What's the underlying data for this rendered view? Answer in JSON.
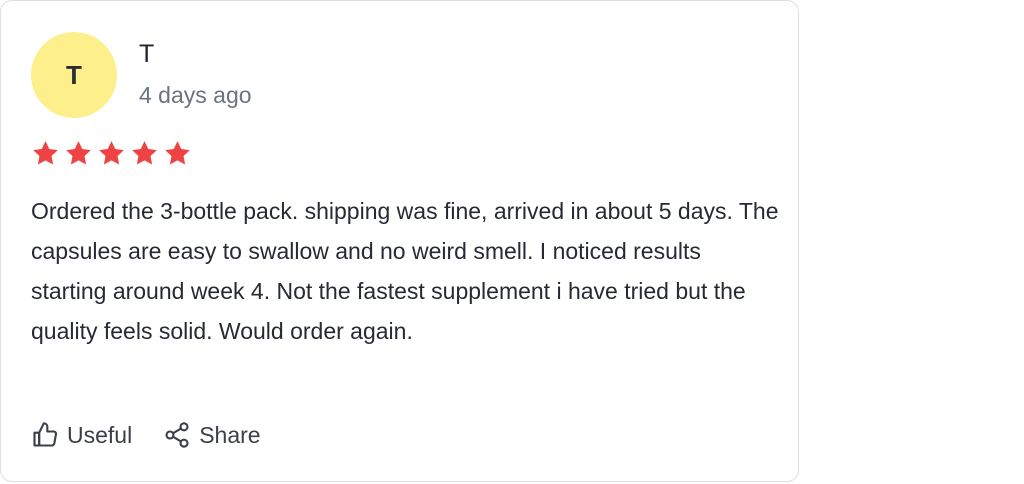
{
  "review": {
    "avatar_initial": "T",
    "author": "T",
    "date": "4 days ago",
    "rating": 5,
    "rating_max": 5,
    "star_color": "#ef4343",
    "avatar_color": "#fdf08a",
    "body": "Ordered the 3-bottle pack. shipping was fine, arrived in about 5 days. The capsules are easy to swallow and no weird smell. I noticed results starting around week 4. Not the fastest supplement i have tried but the quality feels solid. Would order again."
  },
  "actions": {
    "useful": {
      "label": "Useful",
      "icon": "thumbs-up-icon"
    },
    "share": {
      "label": "Share",
      "icon": "share-icon"
    }
  }
}
